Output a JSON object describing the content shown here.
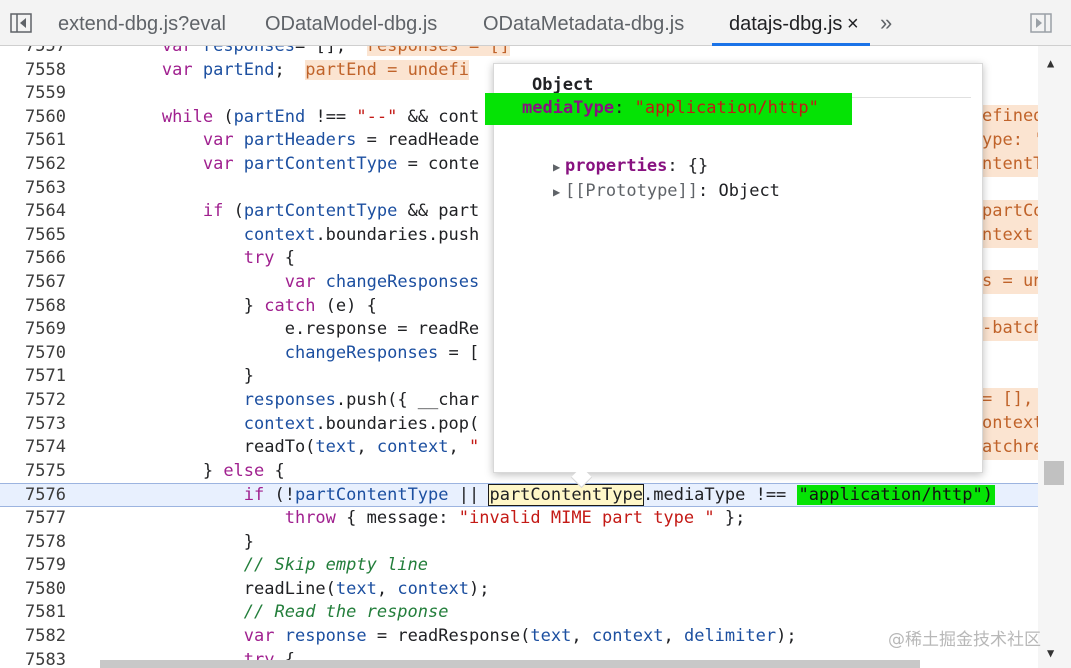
{
  "tabs": [
    {
      "label": "extend-dbg.js?eval",
      "active": false
    },
    {
      "label": "ODataModel-dbg.js",
      "active": false
    },
    {
      "label": "ODataMetadata-dbg.js",
      "active": false
    },
    {
      "label": "datajs-dbg.js",
      "active": true
    }
  ],
  "tab_close": "×",
  "tab_more": "»",
  "code": {
    "lines": [
      {
        "n": "7557",
        "parts": [
          [
            "kw",
            "var "
          ],
          [
            "vr",
            "responses"
          ],
          [
            "",
            "= [];  "
          ],
          [
            "inl",
            "responses = []"
          ]
        ]
      },
      {
        "n": "7558",
        "parts": [
          [
            "kw",
            "var "
          ],
          [
            "vr",
            "partEnd"
          ],
          [
            "",
            ";  "
          ],
          [
            "inl",
            "partEnd = undefi"
          ]
        ]
      },
      {
        "n": "7559",
        "parts": []
      },
      {
        "n": "7560",
        "parts": [
          [
            "kw",
            "while "
          ],
          [
            "",
            "("
          ],
          [
            "vr",
            "partEnd"
          ],
          [
            "",
            " !== "
          ],
          [
            "str",
            "\"--\""
          ],
          [
            "",
            " && cont"
          ]
        ]
      },
      {
        "n": "7561",
        "parts": [
          [
            "",
            "    "
          ],
          [
            "kw",
            "var "
          ],
          [
            "vr",
            "partHeaders"
          ],
          [
            "",
            " = readHeade"
          ]
        ]
      },
      {
        "n": "7562",
        "parts": [
          [
            "",
            "    "
          ],
          [
            "kw",
            "var "
          ],
          [
            "vr",
            "partContentType"
          ],
          [
            "",
            " = conte"
          ]
        ]
      },
      {
        "n": "7563",
        "parts": []
      },
      {
        "n": "7564",
        "parts": [
          [
            "",
            "    "
          ],
          [
            "kw",
            "if "
          ],
          [
            "",
            "("
          ],
          [
            "vr",
            "partContentType"
          ],
          [
            "",
            " && part"
          ]
        ]
      },
      {
        "n": "7565",
        "parts": [
          [
            "",
            "        "
          ],
          [
            "vr",
            "context"
          ],
          [
            "",
            ".boundaries.push"
          ]
        ]
      },
      {
        "n": "7566",
        "parts": [
          [
            "",
            "        "
          ],
          [
            "kw",
            "try "
          ],
          [
            "",
            "{"
          ]
        ]
      },
      {
        "n": "7567",
        "parts": [
          [
            "",
            "            "
          ],
          [
            "kw",
            "var "
          ],
          [
            "vr",
            "changeResponses"
          ]
        ]
      },
      {
        "n": "7568",
        "parts": [
          [
            "",
            "        } "
          ],
          [
            "kw",
            "catch "
          ],
          [
            "",
            "(e) {"
          ]
        ]
      },
      {
        "n": "7569",
        "parts": [
          [
            "",
            "            e.response = readRe"
          ]
        ]
      },
      {
        "n": "7570",
        "parts": [
          [
            "",
            "            "
          ],
          [
            "vr",
            "changeResponses"
          ],
          [
            "",
            " = ["
          ]
        ]
      },
      {
        "n": "7571",
        "parts": [
          [
            "",
            "        }"
          ]
        ]
      },
      {
        "n": "7572",
        "parts": [
          [
            "",
            "        "
          ],
          [
            "vr",
            "responses"
          ],
          [
            "",
            ".push({ __char"
          ]
        ]
      },
      {
        "n": "7573",
        "parts": [
          [
            "",
            "        "
          ],
          [
            "vr",
            "context"
          ],
          [
            "",
            ".boundaries.pop("
          ]
        ]
      },
      {
        "n": "7574",
        "parts": [
          [
            "",
            "        readTo("
          ],
          [
            "vr",
            "text"
          ],
          [
            ",",
            ""
          ],
          [
            "",
            ", "
          ],
          [
            "vr",
            "context"
          ],
          [
            "",
            ", "
          ],
          [
            "str",
            "\""
          ]
        ]
      },
      {
        "n": "7575",
        "parts": [
          [
            "",
            "    } "
          ],
          [
            "kw",
            "else "
          ],
          [
            "",
            "{"
          ]
        ]
      },
      {
        "n": "7576",
        "parts": [
          [
            "",
            "        "
          ],
          [
            "kw",
            "if "
          ],
          [
            "",
            "(!"
          ],
          [
            "vr",
            "partContentType"
          ],
          [
            "",
            " || "
          ],
          [
            "hl",
            "partContentType"
          ],
          [
            "",
            ".mediaType !== "
          ],
          [
            "hg",
            "\"application/http\")"
          ]
        ]
      },
      {
        "n": "7577",
        "parts": [
          [
            "",
            "            "
          ],
          [
            "kw",
            "throw "
          ],
          [
            "",
            "{ message: "
          ],
          [
            "str",
            "\"invalid MIME part type \""
          ],
          [
            "",
            " };"
          ]
        ]
      },
      {
        "n": "7578",
        "parts": [
          [
            "",
            "        }"
          ]
        ]
      },
      {
        "n": "7579",
        "parts": [
          [
            "",
            "        "
          ],
          [
            "cm",
            "// Skip empty line"
          ]
        ]
      },
      {
        "n": "7580",
        "parts": [
          [
            "",
            "        readLine("
          ],
          [
            "vr",
            "text"
          ],
          [
            "",
            ", "
          ],
          [
            "vr",
            "context"
          ],
          [
            "",
            ");"
          ]
        ]
      },
      {
        "n": "7581",
        "parts": [
          [
            "",
            "        "
          ],
          [
            "cm",
            "// Read the response"
          ]
        ]
      },
      {
        "n": "7582",
        "parts": [
          [
            "",
            "        "
          ],
          [
            "kw",
            "var "
          ],
          [
            "vr",
            "response"
          ],
          [
            "",
            " = readResponse("
          ],
          [
            "vr",
            "text"
          ],
          [
            "",
            ", "
          ],
          [
            "vr",
            "context"
          ],
          [
            "",
            ", "
          ],
          [
            "vr",
            "delimiter"
          ],
          [
            "",
            ");"
          ]
        ]
      },
      {
        "n": "7583",
        "parts": [
          [
            "",
            "        "
          ],
          [
            "kw",
            "try "
          ],
          [
            "",
            "{"
          ]
        ]
      }
    ]
  },
  "side_fragments": [
    {
      "text": "efined, c"
    },
    {
      "text": "ype: 'app"
    },
    {
      "text": "ntentType"
    },
    {
      "text": "partCont"
    },
    {
      "text": "ntext = "
    },
    {
      "text": "s = undef"
    },
    {
      "text": "-batchres"
    },
    {
      "text": "= [], cha"
    },
    {
      "text": "ontext: "
    },
    {
      "text": "atchresp"
    }
  ],
  "popover": {
    "title": "Object",
    "rows": [
      {
        "key": "mediaType",
        "sep": ": ",
        "value": "\"application/http\"",
        "expandable": false
      },
      {
        "key": "properties",
        "sep": ": ",
        "value": "{}",
        "expandable": true
      },
      {
        "key": "[[Prototype]]",
        "sep": ": ",
        "value": "Object",
        "expandable": true
      }
    ]
  },
  "watermark": "@稀土掘金技术社区",
  "colors": {
    "accent": "#1a73e8",
    "highlight_green": "#05e305"
  }
}
